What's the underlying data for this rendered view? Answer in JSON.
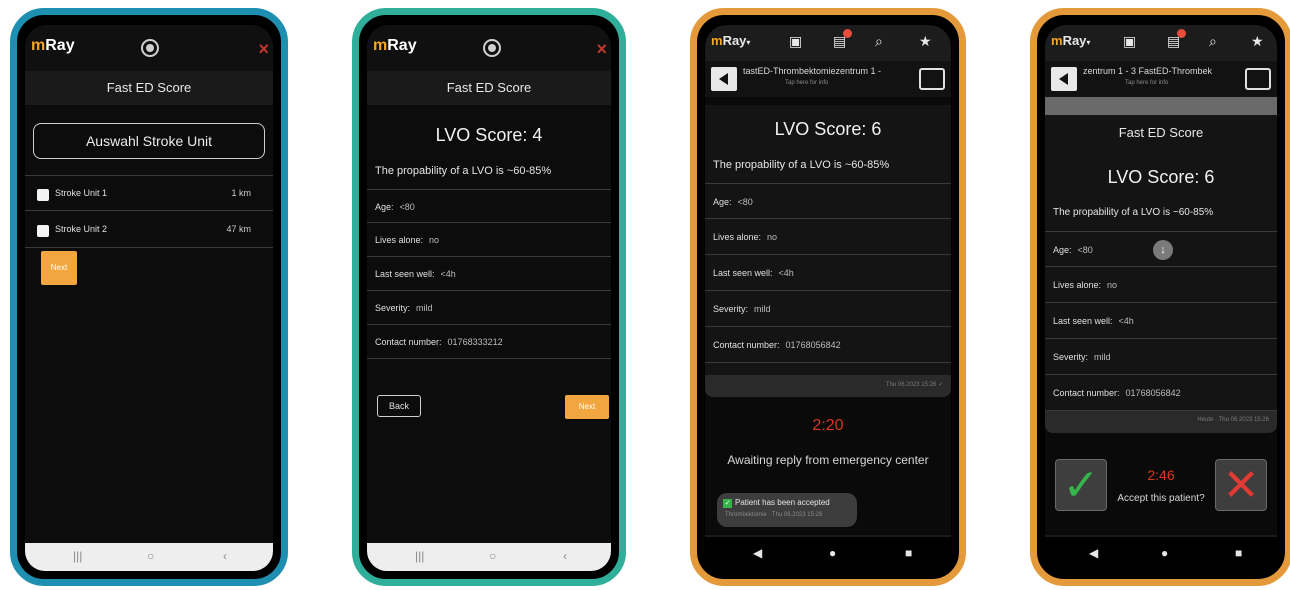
{
  "phone1": {
    "logo_m": "m",
    "logo_rest": "Ray",
    "close": "×",
    "title": "Fast ED Score",
    "select_button": "Auswahl Stroke Unit",
    "units": [
      {
        "name": "Stroke Unit 1",
        "distance": "1 km"
      },
      {
        "name": "Stroke Unit 2",
        "distance": "47 km"
      }
    ],
    "next_button": "Next",
    "nav": {
      "recent": "|||",
      "home": "○",
      "back": "‹"
    }
  },
  "phone2": {
    "logo_m": "m",
    "logo_rest": "Ray",
    "close": "×",
    "title": "Fast ED Score",
    "lvo_label": "LVO Score:",
    "lvo_value": "4",
    "probability": "The propability of a LVO is ~60-85%",
    "fields": [
      {
        "label": "Age:",
        "value": "<80"
      },
      {
        "label": "Lives alone:",
        "value": "no"
      },
      {
        "label": "Last seen well:",
        "value": "<4h"
      },
      {
        "label": "Severity:",
        "value": "mild"
      },
      {
        "label": "Contact number:",
        "value": "01768333212"
      }
    ],
    "back_button": "Back",
    "next_button": "Next",
    "nav": {
      "recent": "|||",
      "home": "○",
      "back": "‹"
    }
  },
  "phone3": {
    "logo_m": "m",
    "logo_rest": "Ray",
    "logo_arrow": "▾",
    "chat_name": "tastED-Thrombektomiezentrum 1 -",
    "chat_sub": "Tap here for info",
    "lvo_label": "LVO Score:",
    "lvo_value": "6",
    "probability": "The propability of a LVO is ~60-85%",
    "fields": [
      {
        "label": "Age:",
        "value": "<80"
      },
      {
        "label": "Lives alone:",
        "value": "no"
      },
      {
        "label": "Last seen well:",
        "value": "<4h"
      },
      {
        "label": "Severity:",
        "value": "mild"
      },
      {
        "label": "Contact number:",
        "value": "01768056842"
      }
    ],
    "msg_time": "Thu 06.2023 15:26 ✓",
    "timer": "2:20",
    "awaiting": "Awaiting reply from emergency center",
    "accepted_text": "Patient has been accepted",
    "accepted_time": "Thrombektomie · Thu 06.2023 15:26",
    "nav": {
      "back": "◀",
      "home": "●",
      "recent": "■"
    }
  },
  "phone4": {
    "logo_m": "m",
    "logo_rest": "Ray",
    "logo_arrow": "▾",
    "chat_name": "zentrum 1 - 3 FastED-Thrombek",
    "chat_sub": "Tap here for info",
    "title": "Fast ED Score",
    "lvo_label": "LVO Score:",
    "lvo_value": "6",
    "probability": "The propability of a LVO is ~60-85%",
    "fields": [
      {
        "label": "Age:",
        "value": "<80"
      },
      {
        "label": "Lives alone:",
        "value": "no"
      },
      {
        "label": "Last seen well:",
        "value": "<4h"
      },
      {
        "label": "Severity:",
        "value": "mild"
      },
      {
        "label": "Contact number:",
        "value": "01768056842"
      }
    ],
    "msg_time": "Heute · Thu 06.2023 15:26",
    "timer": "2:46",
    "accept_question": "Accept this patient?",
    "accept_icon": "✓",
    "reject_icon": "✕",
    "nav": {
      "back": "◀",
      "home": "●",
      "recent": "■"
    }
  },
  "colors": {
    "accent_orange": "#f2a640",
    "frame_blue": "#1e8fb0",
    "frame_teal": "#2fae9a",
    "frame_orange": "#e49a3b",
    "timer_red": "#d9381e",
    "accept_green": "#36b34a",
    "reject_red": "#e03a32"
  }
}
